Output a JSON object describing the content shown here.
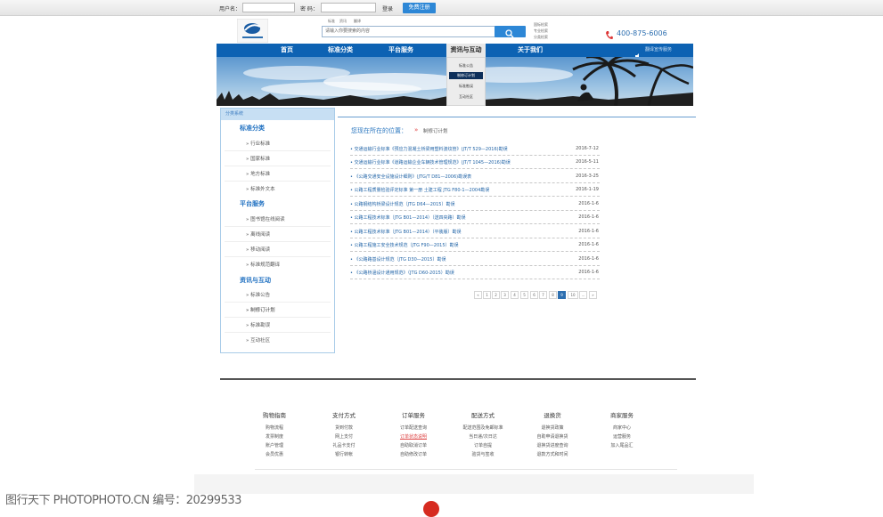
{
  "topbar": {
    "username_label": "用户名：",
    "password_label": "密 码：",
    "login_label": "登录",
    "register_label": "免费注册"
  },
  "search": {
    "tabs": [
      "标准",
      "资讯",
      "翻译"
    ],
    "placeholder": "请输入你要搜索的内容",
    "quick_links": [
      "国标检索",
      "专业检索",
      "分类检索"
    ]
  },
  "phone": "400-875-6006",
  "nav": {
    "items": [
      "首页",
      "标准分类",
      "平台服务",
      "资讯与互动",
      "关于我们"
    ],
    "active": "资讯与互动",
    "right": "翻译宣传服务"
  },
  "dropdown": {
    "items": [
      "标准公告",
      "制修订计划",
      "标准勘误",
      "互动社区"
    ],
    "selected": "制修订计划"
  },
  "sidebar": {
    "header": "分类系统",
    "groups": [
      {
        "title": "标准分类",
        "items": [
          "行业标准",
          "国家标准",
          "地方标准",
          "标准外文本"
        ]
      },
      {
        "title": "平台服务",
        "items": [
          "图书馆在线阅读",
          "离线阅读",
          "移动阅读",
          "标准规范翻译"
        ]
      },
      {
        "title": "资讯与互动",
        "items": [
          "标准公告",
          "制修订计划",
          "标准勘误",
          "互动社区"
        ]
      }
    ]
  },
  "location": {
    "label": "您现在所在的位置：",
    "current": "制修订计划"
  },
  "articles": [
    {
      "title": "交通运输行业标准《预应力混凝土桥梁用塑料波纹管》(JT/T 529—2016)勘误",
      "date": "2016-7-12"
    },
    {
      "title": "交通运输行业标准《道路运输企业车辆技术管理规范》(JT/T 1045—2016)勘误",
      "date": "2016-5-11"
    },
    {
      "title": "《公路交通安全设施设计细则》(JTG/T D81—2006)勘误表",
      "date": "2016-3-25"
    },
    {
      "title": "公路工程质量检验评定标准 第一册 土建工程 JTG F80-1—2004勘误",
      "date": "2016-1-19"
    },
    {
      "title": "公路钢结构桥梁设计规范（JTG D64—2015）勘误",
      "date": "2016-1-6"
    },
    {
      "title": "公路工程技术标准（JTG B01—2014）（送四央路）勘误",
      "date": "2016-1-6"
    },
    {
      "title": "公路工程技术标准（JTG B01—2014）（平装版）勘误",
      "date": "2016-1-6"
    },
    {
      "title": "公路工程施工安全技术规范（JTG F90—2015）勘误",
      "date": "2016-1-6"
    },
    {
      "title": "《公路路基设计规范（JTG D30—2015）勘误",
      "date": "2016-1-6"
    },
    {
      "title": "《公路桥涵设计通用规范》（JTG D60-2015）勘误",
      "date": "2016-1-6"
    }
  ],
  "pagination": [
    "«",
    "1",
    "2",
    "3",
    "4",
    "5",
    "6",
    "7",
    "8",
    "9",
    "10",
    "...",
    "»"
  ],
  "pagination_current": "9",
  "footer": {
    "columns": [
      {
        "title": "购物指南",
        "items": [
          "购物流程",
          "发票制度",
          "账户管理",
          "会员优惠"
        ]
      },
      {
        "title": "支付方式",
        "items": [
          "货到付款",
          "网上支付",
          "礼品卡支付",
          "银行转帐"
        ]
      },
      {
        "title": "订单服务",
        "items": [
          "订单配送查询",
          "订单状态说明",
          "自助取消订单",
          "自助修改订单"
        ]
      },
      {
        "title": "配送方式",
        "items": [
          "配送范围及免邮标准",
          "当日递/次日达",
          "订单自提",
          "验货与签收"
        ]
      },
      {
        "title": "退换货",
        "items": [
          "退换货政策",
          "自助申请退换货",
          "退换货进度查询",
          "退款方式和时间"
        ]
      },
      {
        "title": "商家服务",
        "items": [
          "商家中心",
          "运营服务",
          "加入尾品汇"
        ]
      }
    ],
    "highlighted_item": "订单状态说明"
  },
  "watermark": "图行天下 PHOTOPHOTO.CN   编号：20299533",
  "colors": {
    "nav": "#0d62b3",
    "accent": "#2d87d6",
    "link": "#2466a8"
  }
}
